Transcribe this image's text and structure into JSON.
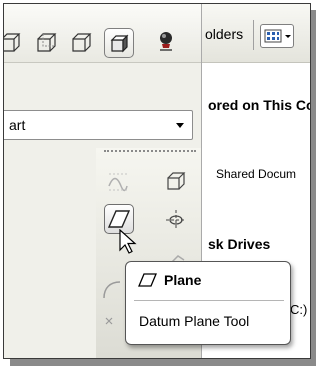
{
  "toolbar": {
    "icons": [
      "wireframe-cube-icon",
      "hidden-line-cube-icon",
      "no-hidden-cube-icon",
      "shaded-cube-icon",
      "light-bulb-icon"
    ]
  },
  "part_combo": {
    "value": "art"
  },
  "explorer": {
    "folders_label": "olders",
    "section_stored": "ored on This Co",
    "shared_docs": "Shared Docum",
    "section_disk": "sk Drives",
    "drive_c": "C:)"
  },
  "tooltip": {
    "title": "Plane",
    "description": "Datum Plane Tool"
  }
}
